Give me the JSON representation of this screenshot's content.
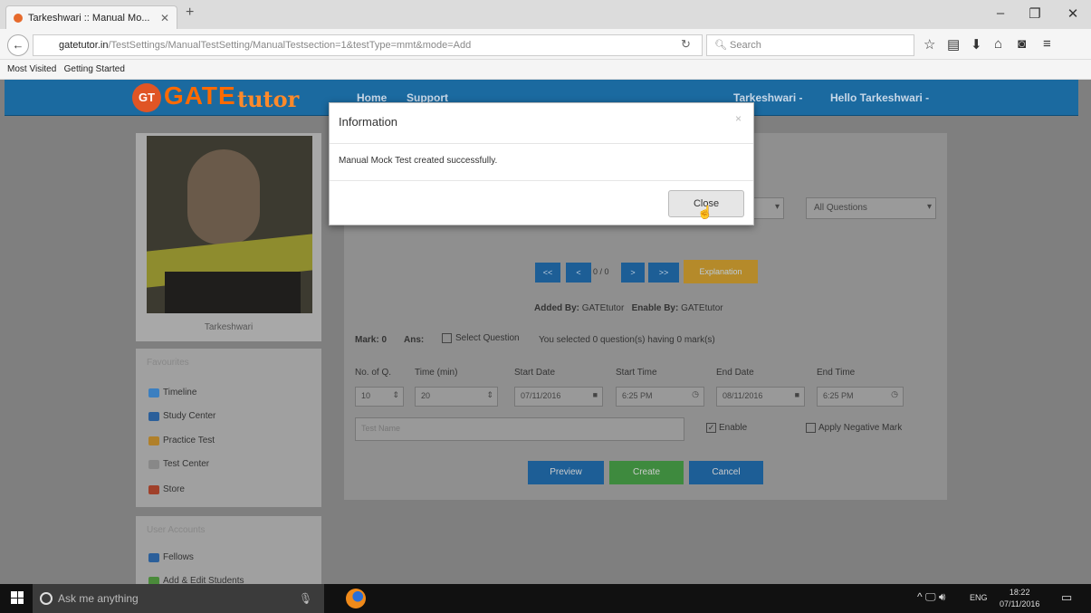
{
  "browser": {
    "tab_title": "Tarkeshwari :: Manual Mo...",
    "url_host": "gatetutor.in",
    "url_path": "/TestSettings/ManualTestSetting/ManualTestsection=1&testType=mmt&mode=Add",
    "search_placeholder": "Search",
    "bookmarks": [
      "Most Visited",
      "Getting Started"
    ]
  },
  "site": {
    "logo_badge": "GT",
    "logo_gate": "GATE",
    "logo_tutor": "tutor",
    "nav_left": [
      "Home",
      "Support"
    ],
    "nav_user": "Tarkeshwari -",
    "nav_hello": "Hello Tarkeshwari -"
  },
  "sidebar": {
    "profile_name": "Tarkeshwari",
    "favourites_title": "Favourites",
    "favourites": [
      "Timeline",
      "Study Center",
      "Practice Test",
      "Test Center",
      "Store"
    ],
    "user_accounts_title": "User Accounts",
    "user_accounts": [
      "Fellows",
      "Add & Edit Students"
    ]
  },
  "content": {
    "filter_select": "All Questions",
    "pager": {
      "first": "<<",
      "prev": "<",
      "count": "0 / 0",
      "next": ">",
      "last": ">>",
      "explanation": "Explanation"
    },
    "added_by_label": "Added By:",
    "added_by": "GATEtutor",
    "enable_by_label": "Enable By:",
    "enable_by": "GATEtutor",
    "mark_text": "Mark: 0",
    "ans_text": "Ans:",
    "select_question": "Select Question",
    "selected_summary": "You selected 0 question(s) having 0 mark(s)",
    "fields": {
      "no_of_q_label": "No. of Q.",
      "no_of_q": "10",
      "time_label": "Time (min)",
      "time": "20",
      "start_date_label": "Start Date",
      "start_date": "07/11/2016",
      "start_time_label": "Start Time",
      "start_time": "6:25 PM",
      "end_date_label": "End Date",
      "end_date": "08/11/2016",
      "end_time_label": "End Time",
      "end_time": "6:25 PM"
    },
    "test_name_placeholder": "Test Name",
    "enable_label": "Enable",
    "negative_label": "Apply Negative Mark",
    "buttons": {
      "preview": "Preview",
      "create": "Create",
      "cancel": "Cancel"
    }
  },
  "modal": {
    "title": "Information",
    "message": "Manual Mock Test created successfully.",
    "close": "Close"
  },
  "taskbar": {
    "search": "Ask me anything",
    "lang": "ENG",
    "time": "18:22",
    "date": "07/11/2016"
  }
}
